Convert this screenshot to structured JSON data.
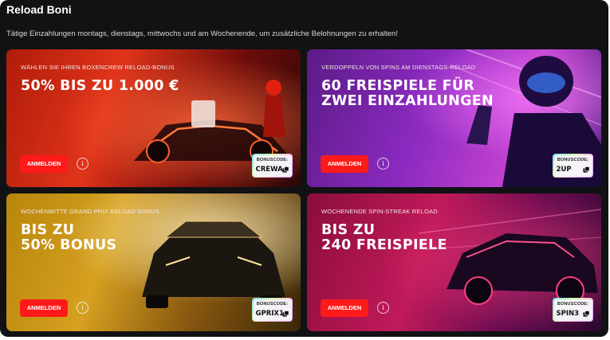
{
  "page": {
    "title": "Reload Boni",
    "subtitle": "Tätige Einzahlungen montags, dienstags, mittwochs und am Wochenende, um zusätzliche Belohnungen zu erhalten!"
  },
  "cards": [
    {
      "label": "WÄHLEN SIE IHREN BOXENCREW RELOAD-BONUS",
      "headline_line1": "50% BIS ZU 1.000 €",
      "headline_line2": "",
      "button": "ANMELDEN",
      "info": "i",
      "code_label": "BONUSCODE:",
      "code": "CREWA"
    },
    {
      "label": "VERDOPPELN VON SPINS AM DIENSTAGS-RELOAD",
      "headline_line1": "60 FREISPIELE FÜR",
      "headline_line2": "ZWEI EINZAHLUNGEN",
      "button": "ANMELDEN",
      "info": "i",
      "code_label": "BONUSCODE:",
      "code": "2UP"
    },
    {
      "label": "WOCHENMITTE GRAND PRIX RELOAD BONUS",
      "headline_line1": "BIS ZU",
      "headline_line2": "50% BONUS",
      "button": "ANMELDEN",
      "info": "i",
      "code_label": "BONUSCODE:",
      "code": "GPRIX1"
    },
    {
      "label": "WOCHENENDE SPIN-STREAK RELOAD",
      "headline_line1": "BIS ZU",
      "headline_line2": "240 FREISPIELE",
      "button": "ANMELDEN",
      "info": "i",
      "code_label": "BONUSCODE:",
      "code": "SPIN3"
    }
  ],
  "colors": {
    "panel_bg": "#111214",
    "button_red": "#ff1a1a"
  },
  "icons": {
    "info": "info-icon",
    "copy": "copy-icon"
  }
}
